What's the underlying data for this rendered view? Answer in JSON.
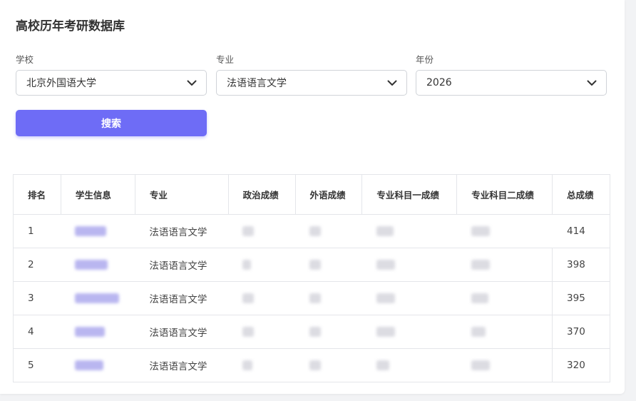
{
  "page": {
    "title": "高校历年考研数据库"
  },
  "filters": {
    "school": {
      "label": "学校",
      "value": "北京外国语大学"
    },
    "major": {
      "label": "专业",
      "value": "法语语言文学"
    },
    "year": {
      "label": "年份",
      "value": "2026"
    }
  },
  "search_button": "搜索",
  "table": {
    "headers": [
      "排名",
      "学生信息",
      "专业",
      "政治成绩",
      "外语成绩",
      "专业科目一成绩",
      "专业科目二成绩",
      "总成绩"
    ],
    "rows": [
      {
        "rank": "1",
        "major": "法语语言文学",
        "total": "414"
      },
      {
        "rank": "2",
        "major": "法语语言文学",
        "total": "398"
      },
      {
        "rank": "3",
        "major": "法语语言文学",
        "total": "395"
      },
      {
        "rank": "4",
        "major": "法语语言文学",
        "total": "370"
      },
      {
        "rank": "5",
        "major": "法语语言文学",
        "total": "320"
      }
    ]
  },
  "icons": {
    "dropdown": "chevron-down-icon"
  },
  "colors": {
    "accent": "#6e6cf6"
  }
}
